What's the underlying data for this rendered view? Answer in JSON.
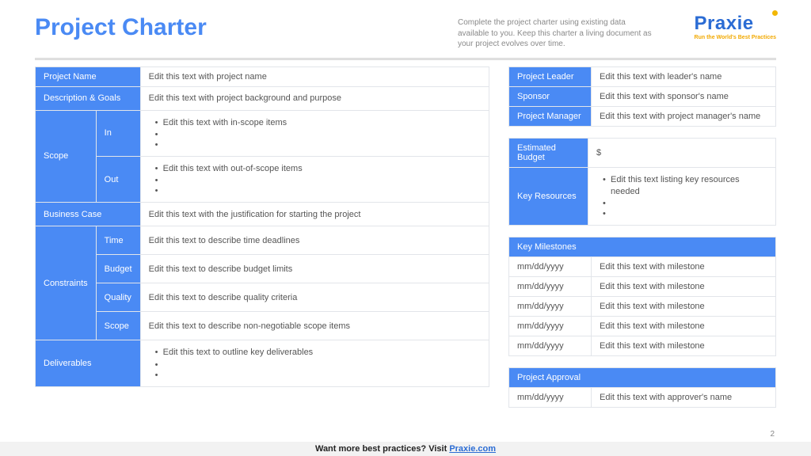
{
  "title": "Project Charter",
  "instructions": "Complete the project charter using existing data available to you. Keep this charter a living document as your project evolves over time.",
  "logo": {
    "brand": "Praxie",
    "tagline": "Run the World's Best Practices"
  },
  "left": {
    "project_name_label": "Project Name",
    "project_name_value": "Edit this text with project name",
    "description_label": "Description & Goals",
    "description_value": "Edit this text with project background and purpose",
    "scope_label": "Scope",
    "scope_in_label": "In",
    "scope_in_item": "Edit this text with in-scope items",
    "scope_out_label": "Out",
    "scope_out_item": "Edit this text with out-of-scope items",
    "business_case_label": "Business Case",
    "business_case_value": "Edit this text with the justification for starting the project",
    "constraints_label": "Constraints",
    "constraints": {
      "time_label": "Time",
      "time_value": "Edit this text to describe time deadlines",
      "budget_label": "Budget",
      "budget_value": "Edit this text to describe budget limits",
      "quality_label": "Quality",
      "quality_value": "Edit this text to describe quality criteria",
      "scope_label": "Scope",
      "scope_value": "Edit this text to describe non-negotiable scope items"
    },
    "deliverables_label": "Deliverables",
    "deliverables_item": "Edit this text to outline key deliverables"
  },
  "right": {
    "leader_label": "Project Leader",
    "leader_value": "Edit this text with leader's name",
    "sponsor_label": "Sponsor",
    "sponsor_value": "Edit this text with sponsor's name",
    "pm_label": "Project Manager",
    "pm_value": "Edit this text with project manager's name",
    "budget_label": "Estimated Budget",
    "budget_value": "$",
    "resources_label": "Key Resources",
    "resources_item": "Edit this text listing key resources needed",
    "milestones_label": "Key Milestones",
    "milestones": [
      {
        "date": "mm/dd/yyyy",
        "text": "Edit this text with milestone"
      },
      {
        "date": "mm/dd/yyyy",
        "text": "Edit this text with milestone"
      },
      {
        "date": "mm/dd/yyyy",
        "text": "Edit this text with milestone"
      },
      {
        "date": "mm/dd/yyyy",
        "text": "Edit this text with milestone"
      },
      {
        "date": "mm/dd/yyyy",
        "text": "Edit this text with milestone"
      }
    ],
    "approval_label": "Project Approval",
    "approval_date": "mm/dd/yyyy",
    "approval_value": "Edit this text with approver's name"
  },
  "page_number": "2",
  "footer": {
    "text": "Want more best practices? Visit ",
    "link": "Praxie.com"
  }
}
